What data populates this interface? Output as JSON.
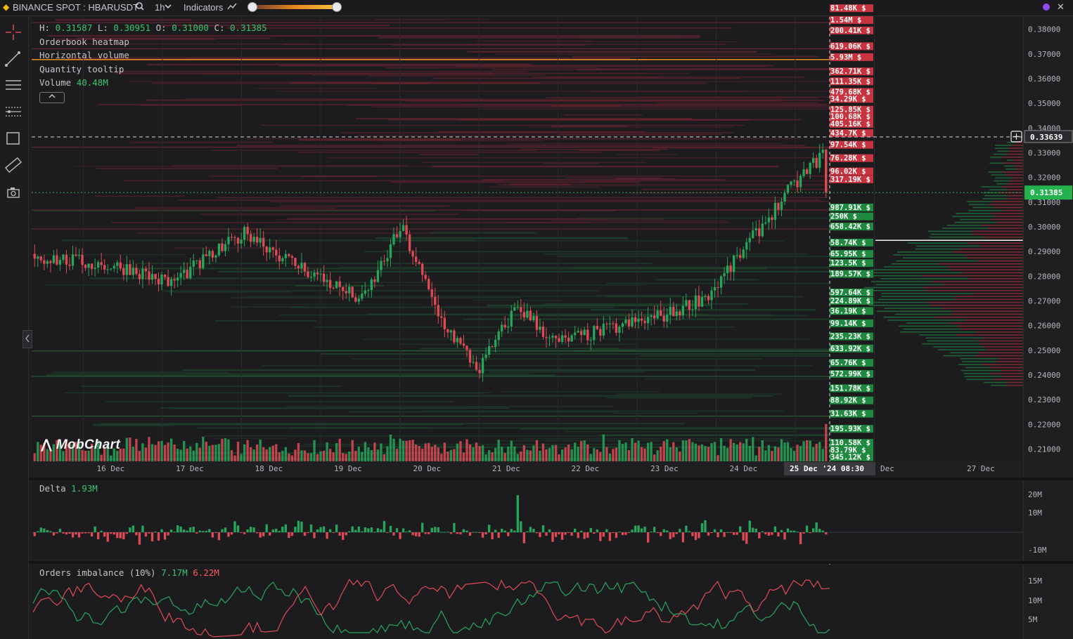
{
  "header": {
    "symbol": "BINANCE SPOT : HBARUSDT",
    "timeframe": "1h",
    "indicators_label": "Indicators",
    "close_label": "✕"
  },
  "legend": {
    "ohlc": {
      "h_label": "H:",
      "h": "0.31587",
      "l_label": "L:",
      "l": "0.30951",
      "o_label": "O:",
      "o": "0.31000",
      "c_label": "C:",
      "c": "0.31385"
    },
    "items": [
      "Orderbook heatmap",
      "Horizontal volume",
      "Quantity tooltip"
    ],
    "volume_label": "Volume",
    "volume_value": "40.48M"
  },
  "watermark": "MobChart",
  "price_axis": {
    "ticks": [
      "0.38000",
      "0.37000",
      "0.36000",
      "0.35000",
      "0.34000",
      "0.33000",
      "0.32000",
      "0.31000",
      "0.30000",
      "0.29000",
      "0.28000",
      "0.27000",
      "0.26000",
      "0.25000",
      "0.24000",
      "0.23000",
      "0.22000",
      "0.21000"
    ],
    "crosshair_price": "0.33639",
    "last_price": "0.31385"
  },
  "time_axis": {
    "labels": [
      "16 Dec",
      "17 Dec",
      "18 Dec",
      "19 Dec",
      "20 Dec",
      "21 Dec",
      "22 Dec",
      "23 Dec",
      "24 Dec",
      "Dec",
      "27 Dec"
    ],
    "crosshair_time": "25 Dec '24  08:30"
  },
  "orderbook_labels": {
    "asks": [
      [
        "81.48K $",
        0.3875
      ],
      [
        "1.54M $",
        0.3827
      ],
      [
        "200.41K $",
        0.3785
      ],
      [
        "619.06K $",
        0.3721
      ],
      [
        "5.93M $",
        0.3677
      ],
      [
        "362.71K $",
        0.3619
      ],
      [
        "111.35K $",
        0.3579
      ],
      [
        "479.68K $",
        0.3536
      ],
      [
        "34.29K $",
        0.3508
      ],
      [
        "125.85K $",
        0.3464
      ],
      [
        "100.68K $",
        0.3436
      ],
      [
        "405.16K $",
        0.3407
      ],
      [
        "434.7K $",
        0.3369
      ],
      [
        "97.54K $",
        0.3322
      ],
      [
        "76.28K $",
        0.3268
      ],
      [
        "96.02K $",
        0.3214
      ],
      [
        "317.19K $",
        0.3182
      ]
    ],
    "bids": [
      [
        "987.91K $",
        0.3068
      ],
      [
        "250K $",
        0.3032
      ],
      [
        "658.42K $",
        0.2991
      ],
      [
        "58.74K $",
        0.2926
      ],
      [
        "65.95K $",
        0.288
      ],
      [
        "123.5K $",
        0.2843
      ],
      [
        "189.57K $",
        0.2799
      ],
      [
        "597.64K $",
        0.2724
      ],
      [
        "224.89K $",
        0.269
      ],
      [
        "36.19K $",
        0.2649
      ],
      [
        "99.14K $",
        0.2599
      ],
      [
        "235.23K $",
        0.2546
      ],
      [
        "633.92K $",
        0.2497
      ],
      [
        "65.76K $",
        0.2439
      ],
      [
        "572.99K $",
        0.2394
      ],
      [
        "151.78K $",
        0.2336
      ],
      [
        "88.92K $",
        0.2287
      ],
      [
        "31.63K $",
        0.2233
      ],
      [
        "195.93K $",
        0.2172
      ],
      [
        "110.58K $",
        0.2115
      ],
      [
        "83.79K $",
        0.2085
      ],
      [
        "345.12K $",
        0.2057
      ]
    ]
  },
  "delta_panel": {
    "title": "Delta",
    "value": "1.93M",
    "ticks": [
      "20M",
      "10M",
      "-10M"
    ]
  },
  "imbalance_panel": {
    "title": "Orders imbalance (10%)",
    "value_green": "7.17M",
    "value_red": "6.22M",
    "ticks": [
      "15M",
      "10M",
      "5M"
    ]
  },
  "chart_data": {
    "type": "candlestick",
    "x_range": [
      "15 Dec",
      "27 Dec"
    ],
    "y_range": [
      0.205,
      0.385
    ],
    "last_close": 0.31385,
    "key_closes": [
      {
        "day": "15 Dec",
        "price": 0.288
      },
      {
        "day": "16 Dec",
        "price": 0.283
      },
      {
        "day": "17 Dec",
        "price": 0.277
      },
      {
        "day": "18 Dec",
        "price": 0.287
      },
      {
        "day": "18 Dec",
        "price": 0.298
      },
      {
        "day": "19 Dec",
        "price": 0.27
      },
      {
        "day": "20 Dec",
        "price": 0.3
      },
      {
        "day": "20 Dec",
        "price": 0.263
      },
      {
        "day": "21 Dec",
        "price": 0.242
      },
      {
        "day": "21 Dec",
        "price": 0.268
      },
      {
        "day": "22 Dec",
        "price": 0.253
      },
      {
        "day": "23 Dec",
        "price": 0.265
      },
      {
        "day": "24 Dec",
        "price": 0.273
      },
      {
        "day": "25 Dec",
        "price": 0.331
      },
      {
        "day": "25 Dec",
        "price": 0.31385
      }
    ],
    "colors": {
      "up": "#26a65b",
      "down": "#e04a55",
      "ask_heat": "#6b2330",
      "bid_heat": "#1d4a2e",
      "accent": "#ff9f1c",
      "last": "#24b24f"
    }
  }
}
